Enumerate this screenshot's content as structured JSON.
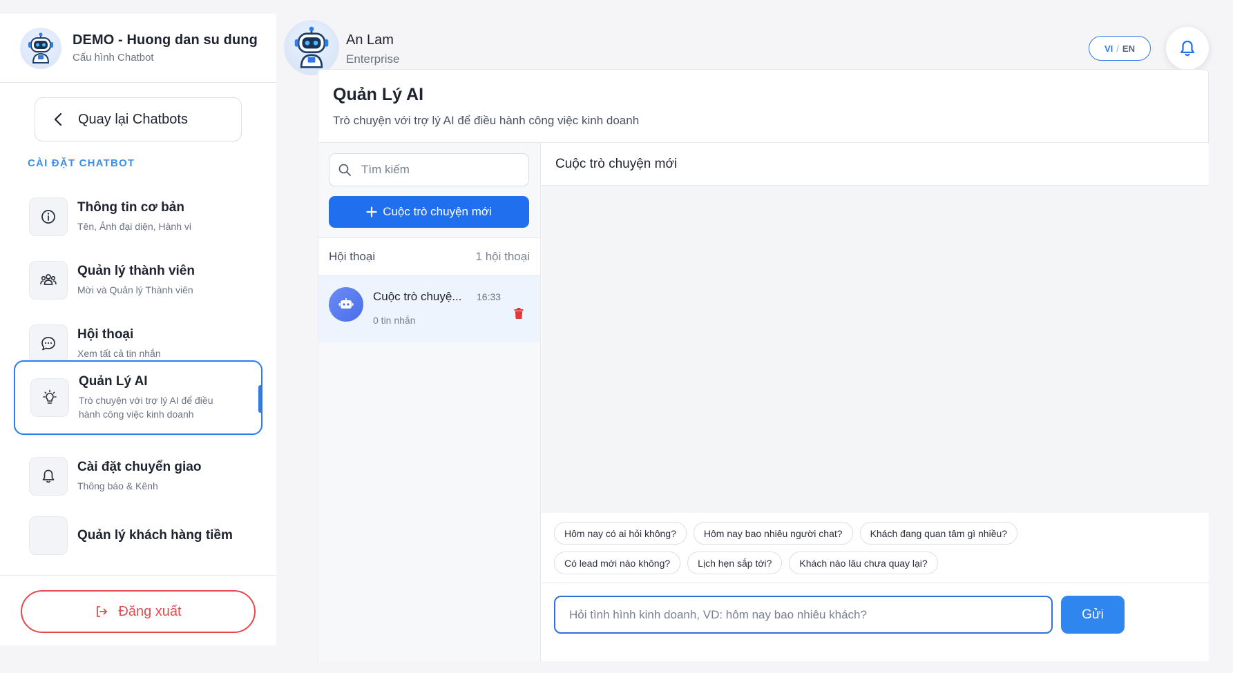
{
  "sidebar": {
    "bot_name": "DEMO - Huong dan su dung",
    "bot_subtitle": "Cấu hình Chatbot",
    "back_label": "Quay lại Chatbots",
    "section_label": "CÀI ĐẶT CHATBOT",
    "items": [
      {
        "label": "Thông tin cơ bản",
        "sub": "Tên, Ảnh đại diện, Hành vi",
        "icon": "info-icon"
      },
      {
        "label": "Quản lý thành viên",
        "sub": "Mời và Quản lý Thành viên",
        "icon": "users-icon"
      },
      {
        "label": "Hội thoại",
        "sub": "Xem tất cả tin nhắn",
        "icon": "chat-bubble-icon"
      },
      {
        "label": "Quản Lý AI",
        "sub": "Trò chuyện với trợ lý AI để điều hành công việc kinh doanh",
        "icon": "lightbulb-icon",
        "active": true
      },
      {
        "label": "Cài đặt chuyển giao",
        "sub": "Thông báo & Kênh",
        "icon": "bell-icon"
      },
      {
        "label": "Quản lý khách hàng tiềm",
        "sub": "",
        "icon": "users-icon"
      }
    ],
    "logout_label": "Đăng xuất"
  },
  "user": {
    "name": "An Lam",
    "plan": "Enterprise"
  },
  "lang": {
    "vi": "VI",
    "sep": "/",
    "en": "EN"
  },
  "page": {
    "title": "Quản Lý AI",
    "subtitle": "Trò chuyện với trợ lý AI để điều hành công việc kinh doanh"
  },
  "list": {
    "search_placeholder": "Tìm kiếm",
    "new_chat_label": "Cuộc trò chuyện mới",
    "header_label": "Hội thoại",
    "header_count": "1 hội thoại",
    "conversations": [
      {
        "title": "Cuộc trò chuyệ...",
        "time": "16:33",
        "meta": "0 tin nhắn"
      }
    ]
  },
  "chat": {
    "title": "Cuộc trò chuyện mới",
    "suggestions_row1": [
      "Hôm nay có ai hỏi không?",
      "Hôm nay bao nhiêu người chat?",
      "Khách đang quan tâm gì nhiều?"
    ],
    "suggestions_row2": [
      "Có lead mới nào không?",
      "Lịch hẹn sắp tới?",
      "Khách nào lâu chưa quay lại?"
    ],
    "input_placeholder": "Hỏi tình hình kinh doanh, VD: hôm nay bao nhiêu khách?",
    "send_label": "Gửi"
  },
  "colors": {
    "accent": "#2f7be8",
    "primary_button": "#1f6fef",
    "danger": "#e5484d",
    "section_label": "#3d8ee8"
  }
}
